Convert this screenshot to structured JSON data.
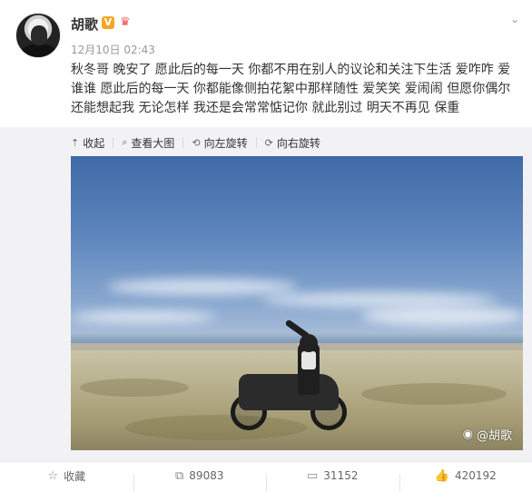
{
  "post": {
    "author": "胡歌",
    "verified_badge": "V",
    "timestamp": "12月10日 02:43",
    "text": "秋冬哥 晚安了 愿此后的每一天 你都不用在别人的议论和关注下生活 爱咋咋 爱谁谁 愿此后的每一天 你都能像侧拍花絮中那样随性 爱笑笑 爱闹闹 但愿你偶尔还能想起我 无论怎样 我还是会常常惦记你 就此别过 明天不再见 保重"
  },
  "media_toolbar": {
    "collapse": "收起",
    "view_large": "查看大图",
    "rotate_left": "向左旋转",
    "rotate_right": "向右旋转"
  },
  "photo": {
    "watermark": "@胡歌"
  },
  "footer": {
    "favorite": "收藏",
    "repost_count": "89083",
    "comment_count": "31152",
    "like_count": "420192"
  },
  "icons": {
    "menu": "chevron-down-icon",
    "collapse": "arrow-up-icon",
    "view_large": "magnifier-icon",
    "rotate_left": "rotate-left-icon",
    "rotate_right": "rotate-right-icon",
    "favorite": "star-icon",
    "repost": "share-icon",
    "comment": "comment-icon",
    "like": "thumbs-up-icon"
  },
  "colors": {
    "badge_orange": "#f5a623",
    "crown_red": "#f24e4e",
    "text": "#333333",
    "muted": "#999999"
  }
}
